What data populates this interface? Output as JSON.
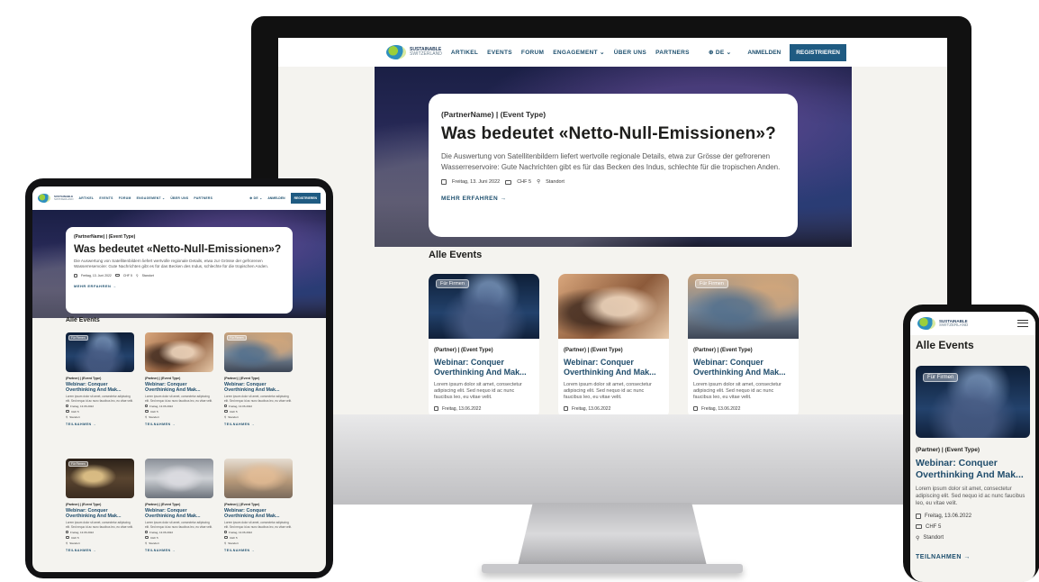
{
  "brand": {
    "line1": "SUSTAINABLE",
    "line2": "SWITZERLAND"
  },
  "nav": {
    "items": [
      "ARTIKEL",
      "EVENTS",
      "FORUM",
      "ENGAGEMENT ⌄",
      "ÜBER UNS",
      "PARTNERS"
    ],
    "language": "⊕ DE ⌄",
    "login": "ANMELDEN",
    "register": "REGISTRIEREN"
  },
  "hero": {
    "tags": "(PartnerName)  |  (Event Type)",
    "title": "Was bedeutet «Netto-Null-Emissionen»?",
    "description": "Die Auswertung von Satellitenbildern liefert wertvolle regionale Details, etwa zur Grösse der gefrorenen Wasserreservoire: Gute Nachrichten gibt es für das Becken des Indus, schlechte für die tropischen Anden.",
    "date": "Freitag, 13. Juni 2022",
    "price": "CHF 5",
    "location": "Standort",
    "cta": "MEHR ERFAHREN →"
  },
  "events_title": "Alle Events",
  "events": [
    {
      "badge": "Für Firmen",
      "tags": "(Partner)  |  (Event Type)",
      "title": "Webinar: Conquer Overthinking And Mak...",
      "excerpt": "Lorem ipsum dolor sit amet, consectetur adipiscing elit. Sed nequo id ac nunc faucibus leo, eu vitae velit.",
      "date": "Freitag, 13.06.2022",
      "price": "CHF 5",
      "location": "Standort",
      "cta": "TEILNAHMEN →"
    },
    {
      "badge": "",
      "tags": "(Partner)  |  (Event Type)",
      "title": "Webinar: Conquer Overthinking And Mak...",
      "excerpt": "Lorem ipsum dolor sit amet, consectetur adipiscing elit. Sed nequo id ac nunc faucibus leo, eu vitae velit.",
      "date": "Freitag, 13.06.2022",
      "price": "CHF 5",
      "location": "Standort",
      "cta": "TEILNAHMEN →"
    },
    {
      "badge": "Für Firmen",
      "tags": "(Partner)  |  (Event Type)",
      "title": "Webinar: Conquer Overthinking And Mak...",
      "excerpt": "Lorem ipsum dolor sit amet, consectetur adipiscing elit. Sed nequo id ac nunc faucibus leo, eu vitae velit.",
      "date": "Freitag, 13.06.2022",
      "price": "CHF 5",
      "location": "Standort",
      "cta": "TEILNAHMEN →"
    },
    {
      "badge": "Für Firmen",
      "tags": "(Partner)  |  (Event Type)",
      "title": "Webinar: Conquer Overthinking And Mak...",
      "excerpt": "Lorem ipsum dolor sit amet, consectetur adipiscing elit. Sed nequo id ac nunc faucibus leo, eu vitae velit.",
      "date": "Freitag, 13.06.2022",
      "price": "CHF 5",
      "location": "Standort",
      "cta": "TEILNAHMEN →"
    },
    {
      "badge": "",
      "tags": "(Partner)  |  (Event Type)",
      "title": "Webinar: Conquer Overthinking And Mak...",
      "excerpt": "Lorem ipsum dolor sit amet, consectetur adipiscing elit. Sed nequo id ac nunc faucibus leo, eu vitae velit.",
      "date": "Freitag, 13.06.2022",
      "price": "CHF 5",
      "location": "Standort",
      "cta": "TEILNAHMEN →"
    },
    {
      "badge": "",
      "tags": "(Partner)  |  (Event Type)",
      "title": "Webinar: Conquer Overthinking And Mak...",
      "excerpt": "Lorem ipsum dolor sit amet, consectetur adipiscing elit. Sed nequo id ac nunc faucibus leo, eu vitae velit.",
      "date": "Freitag, 13.06.2022",
      "price": "CHF 5",
      "location": "Standort",
      "cta": "TEILNAHMEN →"
    }
  ],
  "colors": {
    "accent": "#1f5b82",
    "link": "#1d4f6e",
    "background": "#f4f3ef"
  }
}
